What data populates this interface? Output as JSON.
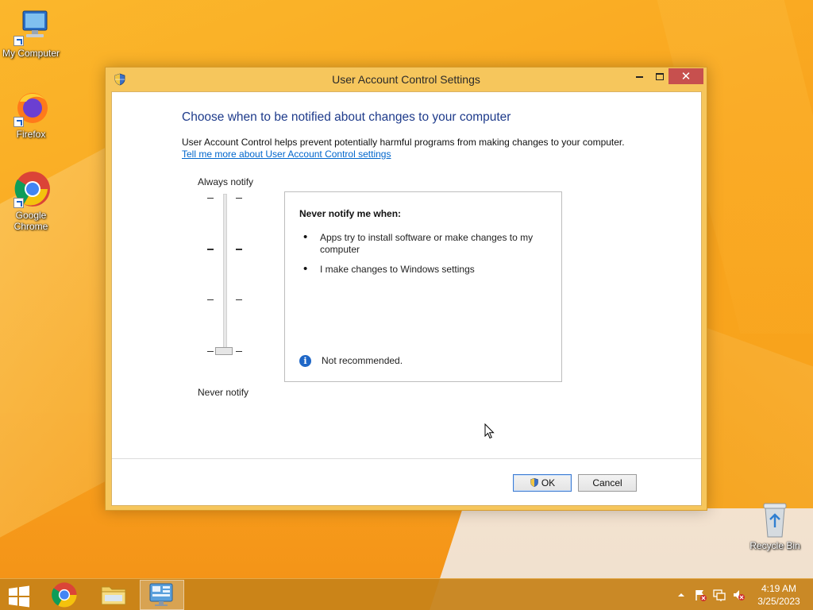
{
  "desktop": {
    "icons": [
      {
        "label": "My Computer",
        "icon": "computer-icon"
      },
      {
        "label": "Firefox",
        "icon": "firefox-icon"
      },
      {
        "label": "Google Chrome",
        "icon": "chrome-icon"
      }
    ],
    "recycle_bin": {
      "label": "Recycle Bin",
      "icon": "recycle-bin-icon"
    }
  },
  "window": {
    "title": "User Account Control Settings",
    "controls": {
      "minimize": "minimize",
      "maximize": "maximize",
      "close": "✕"
    },
    "heading": "Choose when to be notified about changes to your computer",
    "description": "User Account Control helps prevent potentially harmful programs from making changes to your computer.",
    "link": "Tell me more about User Account Control settings",
    "slider": {
      "top_label": "Always notify",
      "bottom_label": "Never notify",
      "levels": 4,
      "selected_level": 1
    },
    "info_box": {
      "title": "Never notify me when:",
      "bullets": [
        "Apps try to install software or make changes to my computer",
        "I make changes to Windows settings"
      ],
      "note": "Not recommended."
    },
    "buttons": {
      "ok": "OK",
      "cancel": "Cancel"
    }
  },
  "taskbar": {
    "apps": [
      {
        "name": "Google Chrome",
        "icon": "chrome-icon"
      },
      {
        "name": "File Explorer",
        "icon": "folder-icon"
      },
      {
        "name": "Control Panel",
        "icon": "control-panel-icon",
        "active": true
      }
    ],
    "tray": [
      "chevron-up-icon",
      "action-center-flag-icon",
      "network-icon",
      "volume-muted-icon"
    ],
    "clock": {
      "time": "4:19 AM",
      "date": "3/25/2023"
    }
  },
  "colors": {
    "accent": "#f6c65c",
    "heading": "#1e3b8b",
    "link": "#0066cc",
    "close_button": "#c7504e",
    "taskbar": "#c78118"
  }
}
